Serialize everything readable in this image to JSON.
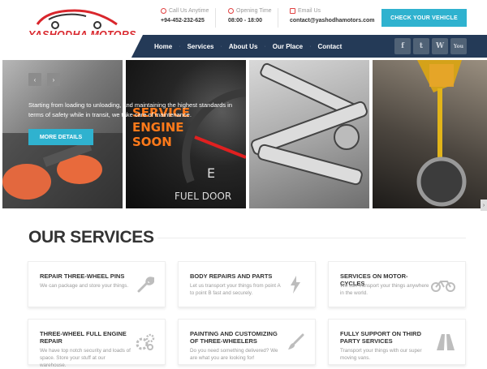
{
  "brand": {
    "name": "YASHODHA MOTORS",
    "accent": "#d9262c"
  },
  "header": {
    "call": {
      "label": "Call Us Anytime",
      "value": "+94-452-232-625"
    },
    "hours": {
      "label": "Opening Time",
      "value": "08:00 - 18:00"
    },
    "email": {
      "label": "Email Us",
      "value": "contact@yashodhamotors.com"
    },
    "cta_label": "CHECK YOUR VEHICLE"
  },
  "nav": {
    "items": [
      "Home",
      "Services",
      "About Us",
      "Our Place",
      "Contact"
    ],
    "social": [
      "f",
      "t",
      "W",
      "You"
    ]
  },
  "slider": {
    "text": "Starting from loading to unloading, and maintaining the highest standards in terms of safety while in transit, we take care of maintenance.",
    "button_label": "MORE DETAILS",
    "prev": "‹",
    "next": "›",
    "side_next": "›"
  },
  "services": {
    "title": "OUR SERVICES",
    "items": [
      {
        "title": "REPAIR THREE-WHEEL PINS",
        "desc": "We can package and store your things.",
        "icon": "wrench-icon"
      },
      {
        "title": "BODY REPAIRS AND PARTS",
        "desc": "Let us transport your things from point A to point B fast and securely.",
        "icon": "lightning-icon"
      },
      {
        "title": "SERVICES ON MOTOR-CYCLES",
        "desc": "We can transport your things anywhere in the world.",
        "icon": "motorcycle-icon"
      },
      {
        "title": "THREE-WHEEL FULL ENGINE REPAIR",
        "desc": "We have top notch security and loads of space. Store your stuff at our warehouse.",
        "icon": "gears-icon"
      },
      {
        "title": "PAINTING AND CUSTOMIZING OF THREE-WHEELERS",
        "desc": "Do you need something delivered? We are what you are looking for!",
        "icon": "paintbrush-icon"
      },
      {
        "title": "FULLY SUPPORT ON THIRD PARTY SERVICES",
        "desc": "Transport your things with our super moving vans.",
        "icon": "road-icon"
      }
    ]
  },
  "colors": {
    "nav_bg": "#243a57",
    "cta": "#2fb2cf"
  }
}
